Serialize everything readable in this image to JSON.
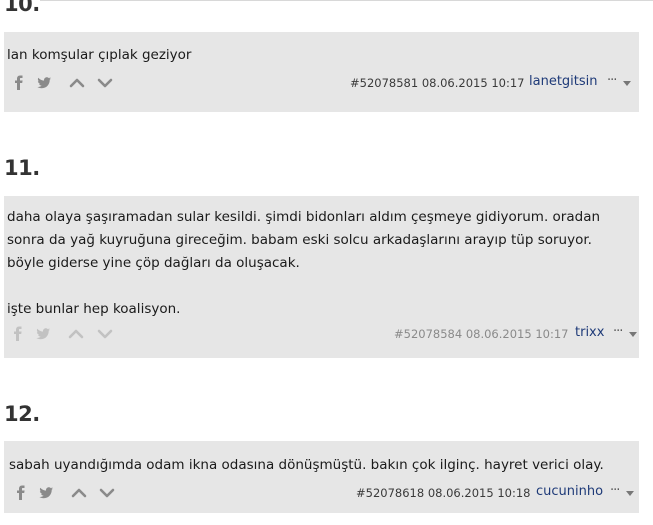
{
  "entries": [
    {
      "number": "10.",
      "text": "lan komşular çıplak geziyor",
      "entry_id": "#52078581",
      "date": "08.06.2015 10:17",
      "author": "lanetgitsin",
      "more": "···"
    },
    {
      "number": "11.",
      "text": "daha olaya şaşıramadan sular kesildi. şimdi bidonları aldım çeşmeye gidiyorum. oradan sonra da yağ kuyruğuna gireceğim. babam eski solcu arkadaşlarını arayıp tüp soruyor. böyle giderse yine çöp dağları da oluşacak.\n\nişte bunlar hep koalisyon.",
      "entry_id": "#52078584",
      "date": "08.06.2015 10:17",
      "author": "trixx",
      "more": "···"
    },
    {
      "number": "12.",
      "text": "sabah uyandığımda odam ikna odasına dönüşmüştü. bakın çok ilginç. hayret verici olay.",
      "entry_id": "#52078618",
      "date": "08.06.2015 10:18",
      "author": "cucuninho",
      "more": "···"
    }
  ],
  "icons": [
    "facebook-icon",
    "twitter-icon",
    "upvote-icon",
    "downvote-icon",
    "chevron-down-icon"
  ],
  "colors": {
    "card_bg": "#e6e6e6",
    "author": "#1e3a78",
    "icon": "#8a8a8a"
  }
}
